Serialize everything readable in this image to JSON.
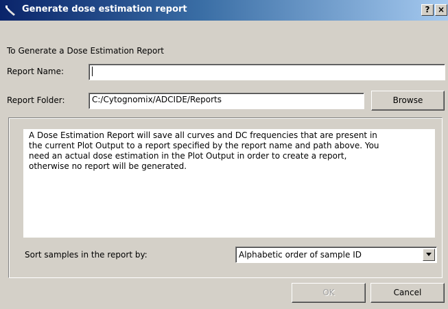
{
  "window": {
    "title": "Generate dose estimation report",
    "help_button": "?",
    "close_button": "×"
  },
  "form": {
    "intro": "To Generate a Dose Estimation Report",
    "report_name_label": "Report Name:",
    "report_name_value": "",
    "report_folder_label": "Report Folder:",
    "report_folder_value": "C:/Cytognomix/ADCIDE/Reports",
    "browse_button": "Browse"
  },
  "description": {
    "lines": [
      "A Dose Estimation Report will save all curves and DC frequencies that are present in",
      "the current Plot Output to a report specified by the report name and path above. You",
      "need an actual dose estimation in the Plot Output in order to create a report,",
      "otherwise no report will be generated."
    ]
  },
  "sort": {
    "label": "Sort samples in the report by:",
    "selected": "Alphabetic order of sample ID"
  },
  "footer": {
    "ok_button": "OK",
    "cancel_button": "Cancel"
  },
  "colors": {
    "titlebar_start": "#0a246a",
    "titlebar_end": "#a6caf0",
    "dialog_bg": "#d4d0c8"
  }
}
